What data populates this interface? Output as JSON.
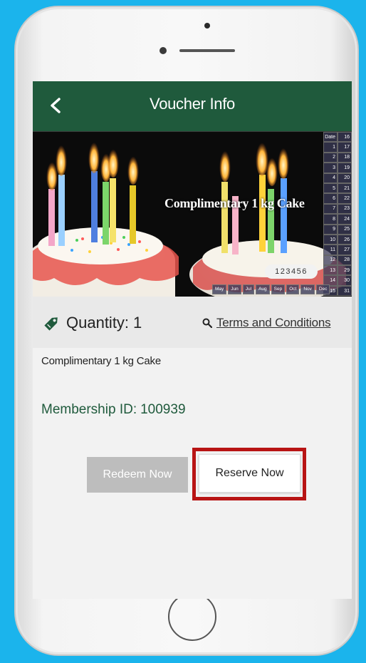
{
  "header": {
    "title": "Voucher Info",
    "back_icon": "chevron-left-icon"
  },
  "banner": {
    "title": "Complimentary 1 kg Cake",
    "code": "123456",
    "calendar_header": "Date",
    "calendar_days": [
      "16",
      "1",
      "17",
      "2",
      "18",
      "3",
      "19",
      "4",
      "20",
      "5",
      "21",
      "6",
      "22",
      "7",
      "23",
      "8",
      "24",
      "9",
      "25",
      "10",
      "26",
      "11",
      "27",
      "12",
      "28",
      "13",
      "29",
      "14",
      "30",
      "15",
      "31"
    ],
    "months": [
      "May",
      "Jun",
      "Jul",
      "Aug",
      "Sep",
      "Oct",
      "Nov",
      "Dec"
    ]
  },
  "info": {
    "quantity_label": "Quantity:",
    "quantity_value": "1",
    "terms_link": "Terms and Conditions",
    "tag_icon": "ticket-tag-icon",
    "search_icon": "search-icon"
  },
  "voucher": {
    "description": "Complimentary 1 kg Cake",
    "membership_label": "Membership ID:",
    "membership_id": "100939"
  },
  "actions": {
    "redeem_label": "Redeem Now",
    "reserve_label": "Reserve Now"
  },
  "colors": {
    "background": "#1bb4ec",
    "header": "#1f5a3c",
    "accent_text": "#1f5a3c",
    "highlight": "#b81414",
    "disabled_button": "#bdbdbd"
  }
}
